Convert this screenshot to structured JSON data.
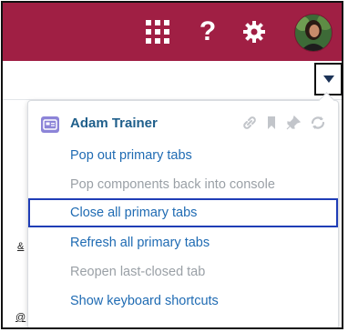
{
  "colors": {
    "header_bg": "#a01f44",
    "link": "#1f6bb3",
    "disabled": "#9aa0a6",
    "focus_border": "#1f3db6",
    "title": "#1f5f8b",
    "contact_icon": "#8c84d8"
  },
  "header_icons": [
    "app-launcher-grid-icon",
    "help-question-icon",
    "setup-gear-icon",
    "user-avatar"
  ],
  "menu": {
    "title": "Adam Trainer",
    "title_icon": "contact-card-icon",
    "action_icons": [
      "link-icon",
      "bookmark-icon",
      "pin-icon",
      "refresh-icon"
    ],
    "items": [
      {
        "label": "Pop out primary tabs",
        "state": "enabled"
      },
      {
        "label": "Pop components back into console",
        "state": "disabled"
      },
      {
        "label": "Close all primary tabs",
        "state": "focused"
      },
      {
        "label": "Refresh all primary tabs",
        "state": "enabled"
      },
      {
        "label": "Reopen last-closed tab",
        "state": "disabled"
      },
      {
        "label": "Show keyboard shortcuts",
        "state": "enabled"
      }
    ]
  },
  "background": {
    "link_fragment_1": "&",
    "link_fragment_2": "@"
  }
}
